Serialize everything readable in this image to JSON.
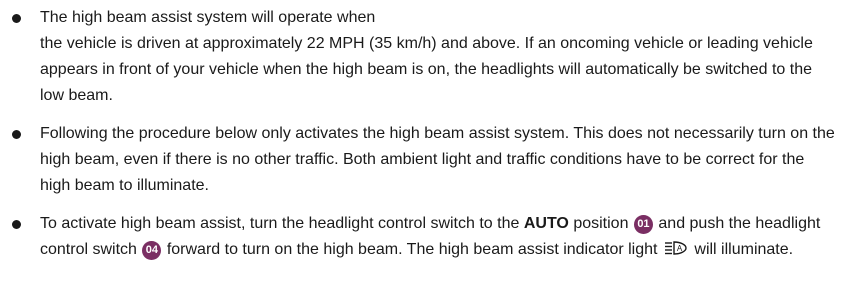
{
  "bullets": [
    {
      "line1": "The high beam assist system will operate when",
      "line2": "the vehicle is driven at approximately 22 MPH (35 km/h) and above. If an oncoming vehicle or leading vehicle appears in front of your vehicle when the high beam is on, the headlights will automatically be switched to the low beam."
    },
    {
      "text": "Following the procedure below only activates the high beam assist system. This does not necessarily turn on the high beam, even if there is no other traffic. Both ambient light and traffic conditions have to be correct for the high beam to illuminate."
    },
    {
      "part1": "To activate high beam assist, turn the headlight control switch to the",
      "auto_label": "AUTO",
      "part2": "position",
      "badge1": "01",
      "part3": "and push the headlight control switch",
      "badge2": "04",
      "part4": "forward to turn on the high beam. The high beam assist indicator light",
      "icon": "high-beam-assist-indicator-icon",
      "part5": "will illuminate."
    }
  ],
  "colors": {
    "badge": "#7a2e63",
    "text": "#1a1a1a"
  }
}
